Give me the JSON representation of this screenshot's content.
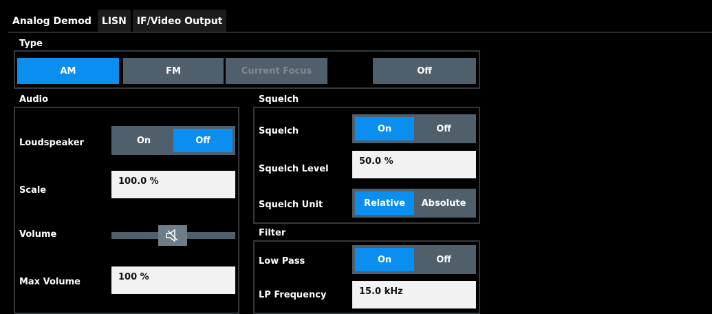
{
  "tabs": [
    {
      "label": "Analog Demod",
      "active": true
    },
    {
      "label": "LISN",
      "active": false
    },
    {
      "label": "IF/Video Output",
      "active": false
    }
  ],
  "type": {
    "title": "Type",
    "buttons": {
      "am": "AM",
      "fm": "FM",
      "current_focus": "Current Focus",
      "off": "Off"
    },
    "selected": "AM"
  },
  "audio": {
    "title": "Audio",
    "loudspeaker_label": "Loudspeaker",
    "loudspeaker": {
      "on": "On",
      "off": "Off",
      "selected": "Off"
    },
    "scale_label": "Scale",
    "scale_value": "100.0 %",
    "volume_label": "Volume",
    "volume_icon": "speaker-muted-icon",
    "max_volume_label": "Max Volume",
    "max_volume_value": "100 %"
  },
  "squelch": {
    "title": "Squelch",
    "squelch_label": "Squelch",
    "squelch": {
      "on": "On",
      "off": "Off",
      "selected": "On"
    },
    "level_label": "Squelch Level",
    "level_value": "50.0 %",
    "unit_label": "Squelch Unit",
    "unit": {
      "relative": "Relative",
      "absolute": "Absolute",
      "selected": "Relative"
    }
  },
  "filter": {
    "title": "Filter",
    "low_pass_label": "Low Pass",
    "low_pass": {
      "on": "On",
      "off": "Off",
      "selected": "On"
    },
    "lp_frequency_label": "LP Frequency",
    "lp_frequency_value": "15.0 kHz"
  },
  "colors": {
    "accent": "#0a8ff0",
    "button": "#4f5f6c",
    "background": "#000000",
    "field": "#f2f2f2"
  }
}
